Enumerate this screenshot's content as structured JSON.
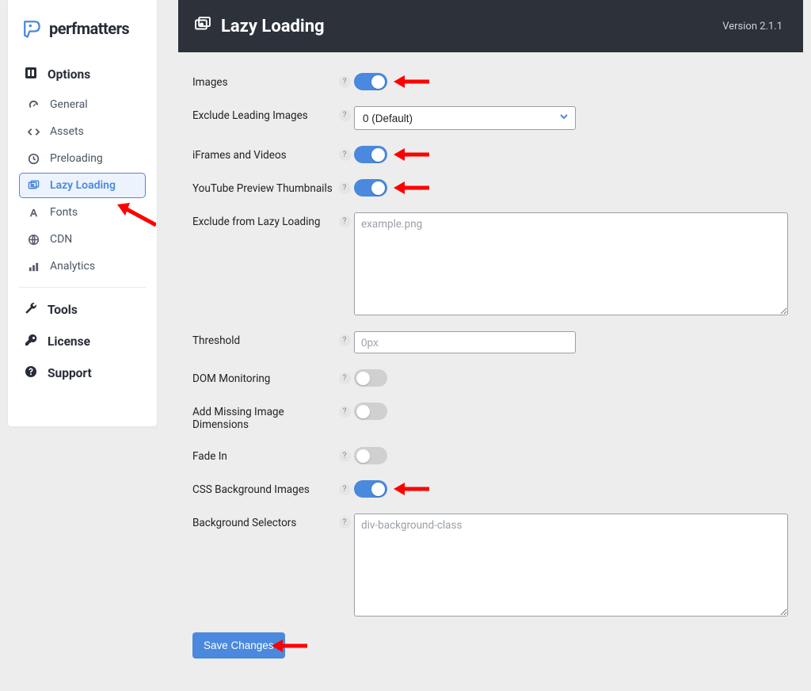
{
  "brand": {
    "name": "perfmatters"
  },
  "sidebar": {
    "section_options": "Options",
    "items": [
      {
        "label": "General"
      },
      {
        "label": "Assets"
      },
      {
        "label": "Preloading"
      },
      {
        "label": "Lazy Loading"
      },
      {
        "label": "Fonts"
      },
      {
        "label": "CDN"
      },
      {
        "label": "Analytics"
      }
    ],
    "tools": "Tools",
    "license": "License",
    "support": "Support"
  },
  "header": {
    "title": "Lazy Loading",
    "version": "Version 2.1.1"
  },
  "form": {
    "images": {
      "label": "Images"
    },
    "exclude_leading": {
      "label": "Exclude Leading Images",
      "selected": "0 (Default)"
    },
    "iframes": {
      "label": "iFrames and Videos"
    },
    "youtube": {
      "label": "YouTube Preview Thumbnails"
    },
    "exclude_ll": {
      "label": "Exclude from Lazy Loading",
      "placeholder": "example.png"
    },
    "threshold": {
      "label": "Threshold",
      "placeholder": "0px"
    },
    "dom": {
      "label": "DOM Monitoring"
    },
    "dims": {
      "label": "Add Missing Image Dimensions"
    },
    "fade": {
      "label": "Fade In"
    },
    "cssbg": {
      "label": "CSS Background Images"
    },
    "bgsel": {
      "label": "Background Selectors",
      "placeholder": "div-background-class"
    },
    "save": "Save Changes"
  }
}
